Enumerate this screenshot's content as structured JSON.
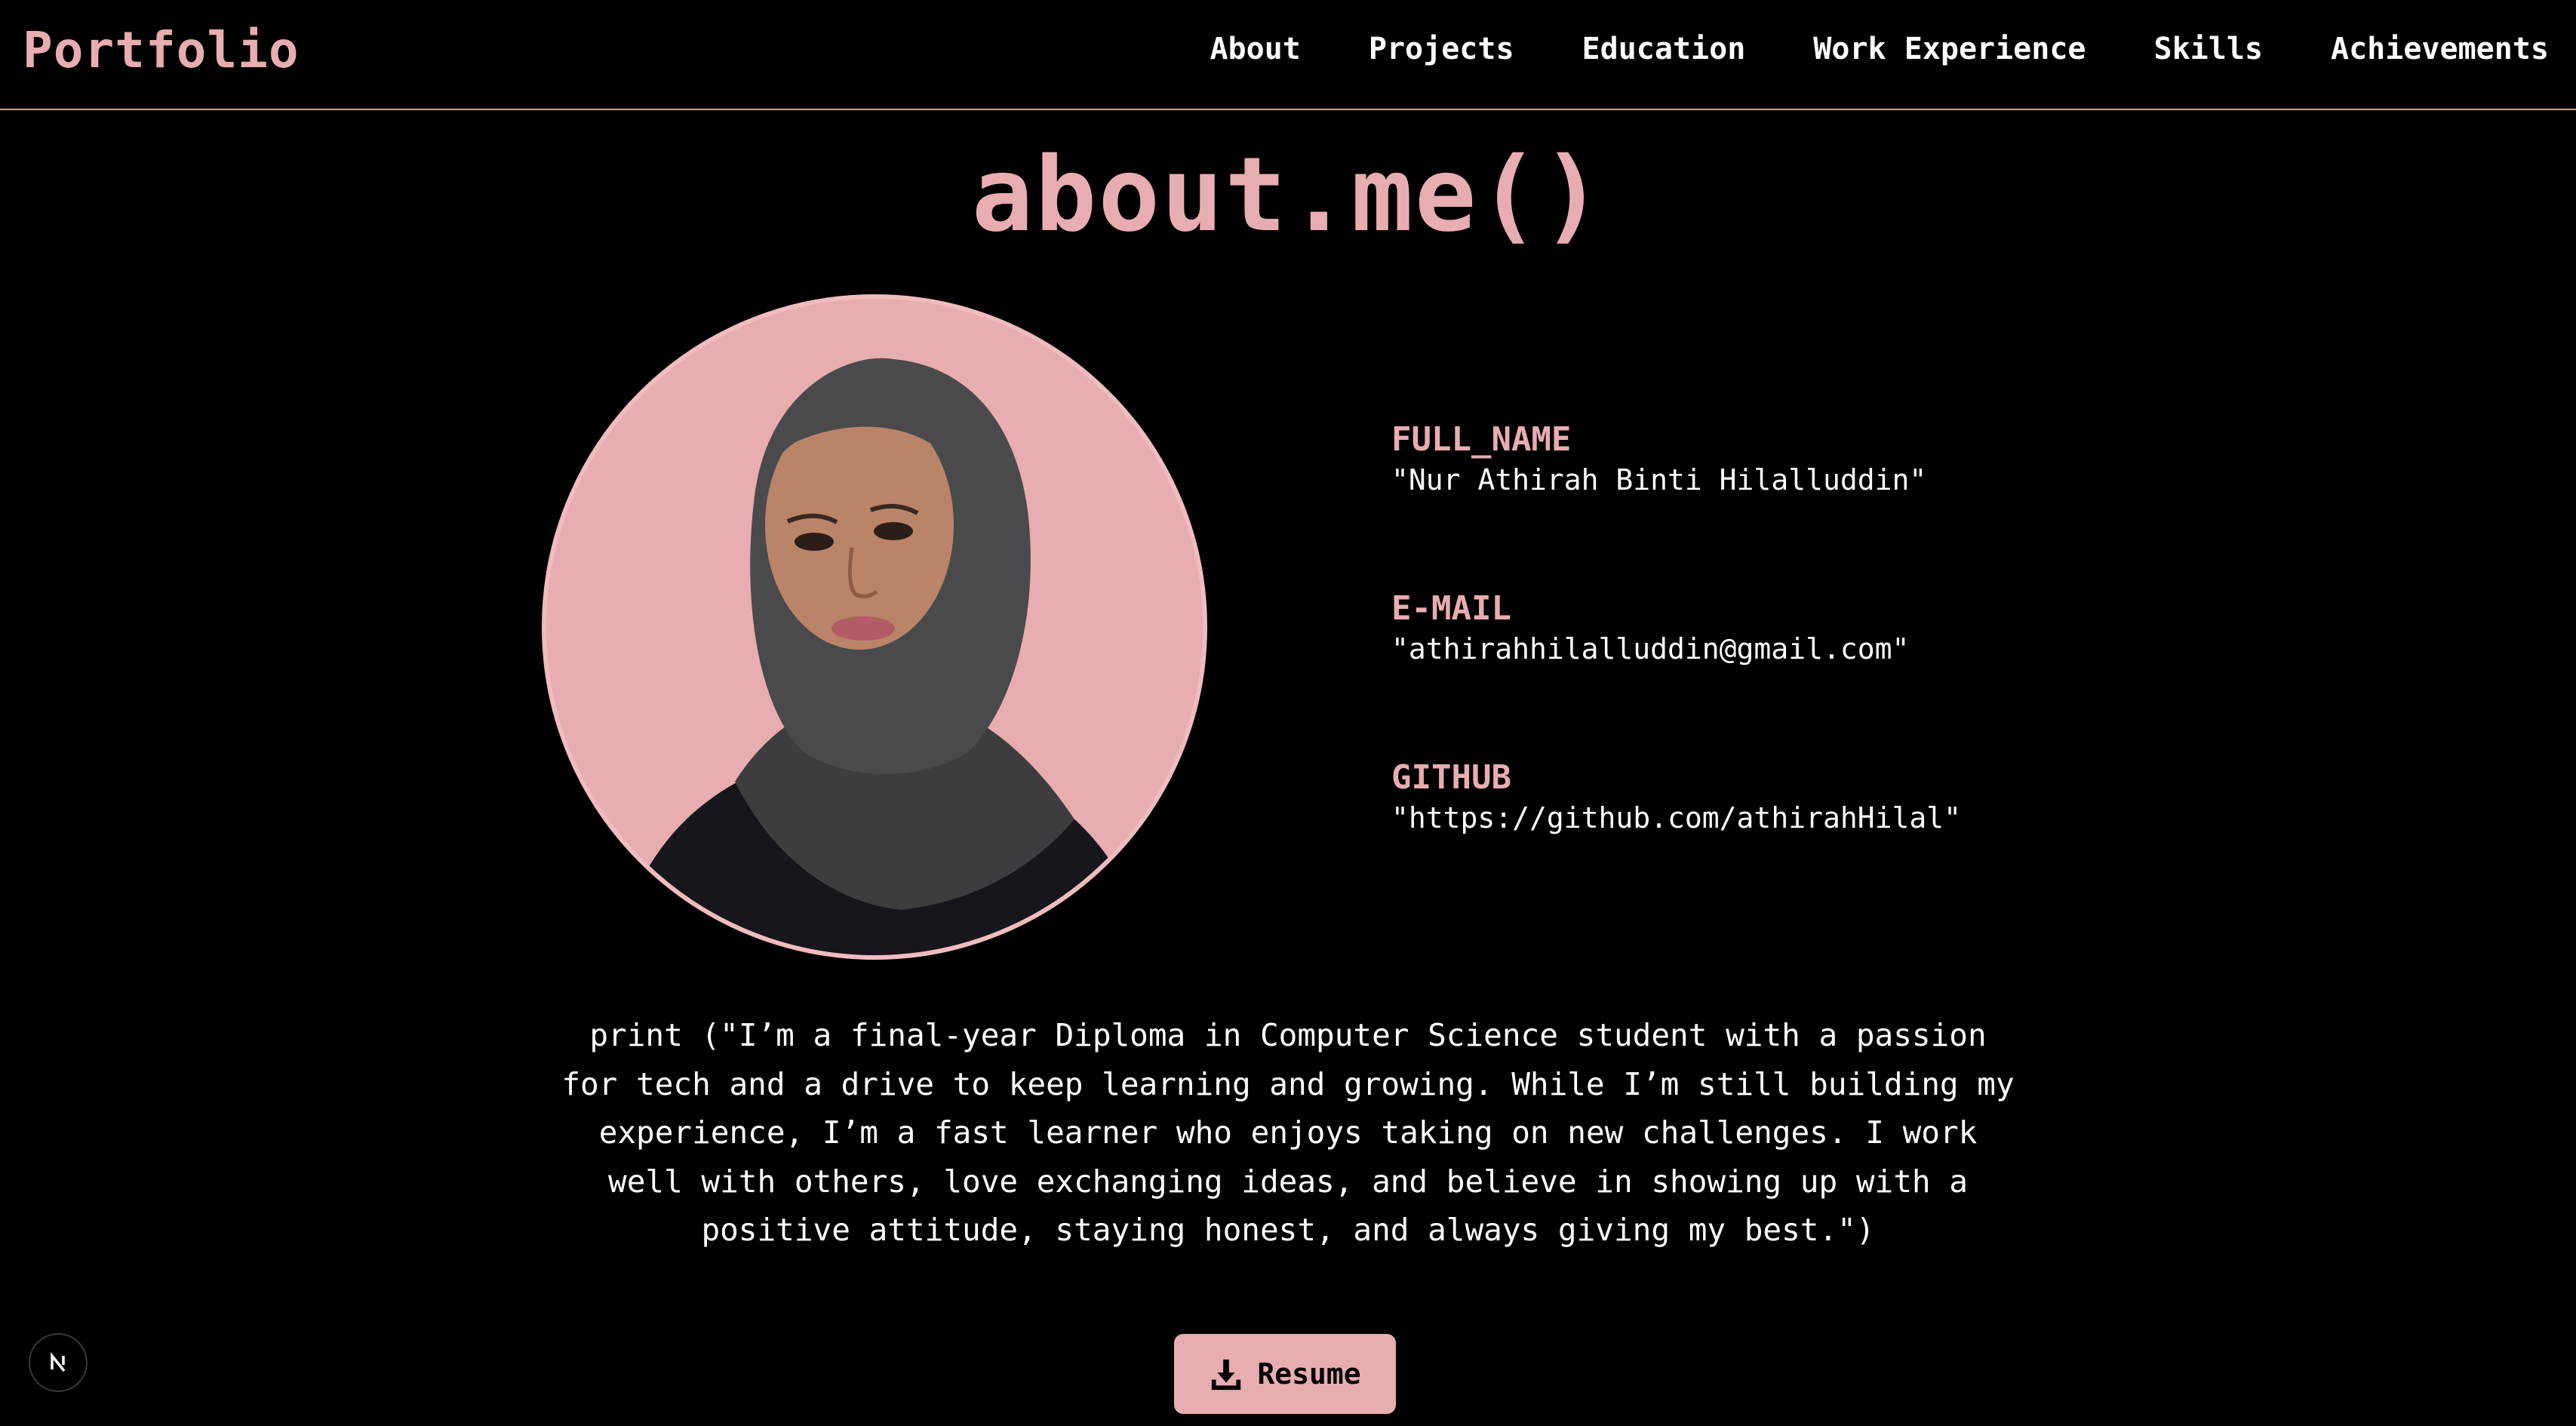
{
  "header": {
    "brand": "Portfolio",
    "nav": [
      {
        "label": "About"
      },
      {
        "label": "Projects"
      },
      {
        "label": "Education"
      },
      {
        "label": "Work Experience"
      },
      {
        "label": "Skills"
      },
      {
        "label": "Achievements"
      }
    ]
  },
  "main": {
    "title": "about.me()",
    "fields": [
      {
        "label": "FULL_NAME",
        "value": "\"Nur Athirah Binti Hilalluddin\""
      },
      {
        "label": "E-MAIL",
        "value": "\"athirahhilalluddin@gmail.com\""
      },
      {
        "label": "GITHUB",
        "value": "\"https://github.com/athirahHilal\""
      }
    ],
    "bio": "print (\"I’m a final-year Diploma in Computer Science student with a passion for tech and a drive to keep learning and growing. While I’m still building my experience, I’m a fast learner who enjoys taking on new challenges. I work well with others, love exchanging ideas, and believe in showing up with a positive attitude, staying honest, and always giving my best.\")",
    "resume_button": "Resume"
  },
  "badge": {
    "letter": "N"
  },
  "colors": {
    "accent": "#e8adb0",
    "background": "#000000",
    "text": "#ffffff",
    "divider": "#c9a79c"
  },
  "icons": {
    "resume": "download-icon",
    "badge": "nextjs-logo-icon"
  }
}
